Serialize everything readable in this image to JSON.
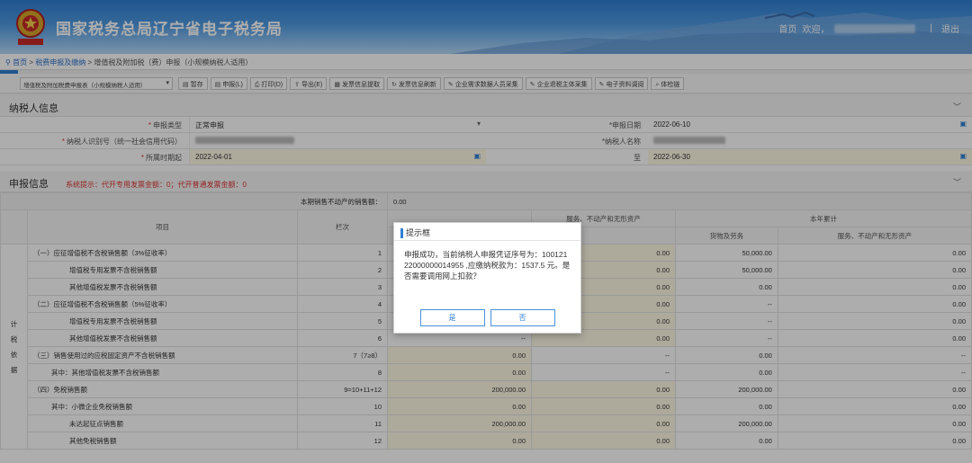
{
  "header": {
    "site_title": "国家税务总局辽宁省电子税务局",
    "nav_home": "首页",
    "nav_welcome": "欢迎，",
    "nav_sep": "|",
    "nav_logout": "退出"
  },
  "breadcrumb": {
    "pin": "⚲",
    "home": "首页",
    "sep1": ">",
    "item1": "税费申报及缴纳",
    "sep2": ">",
    "item2": "增值税及附加税（费）申报（小规模纳税人适用）"
  },
  "toolbar": {
    "menu_icon": "☰",
    "report_select": "增值税及附加税费申报表（小规模纳税人适用）",
    "buttons": [
      "暂存",
      "申报(L)",
      "打印(D)",
      "导出(E)",
      "发票信息提取",
      "发票信息刷新",
      "企业需求数据人员采集",
      "企业退税主体采集",
      "电子资料调阅",
      "体检链"
    ]
  },
  "taxpayer": {
    "section_title": "纳税人信息",
    "decl_type_label": "申报类型",
    "decl_type_value": "正常申报",
    "decl_date_label": "申报日期",
    "decl_date_value": "2022-06-10",
    "tax_id_label": "纳税人识别号（统一社会信用代码）",
    "name_label": "纳税人名称",
    "period_label": "所属时期起",
    "period_start": "2022-04-01",
    "period_to_label": "至",
    "period_end": "2022-06-30"
  },
  "declaration": {
    "section_title": "申报信息",
    "system_hint": "系统提示：代开专用发票金额：0；代开普通发票金额：0",
    "real_estate_label": "本期销售不动产的销售额：",
    "real_estate_value": "0.00",
    "col_item": "项目",
    "col_line": "栏次",
    "col_cumulative": "本年累计",
    "col_goods": "货物及劳务",
    "col_services": "服务、不动产和无形资产",
    "side_label": [
      "计",
      "税",
      "依",
      "据"
    ],
    "rows": [
      {
        "item": "（一）应征增值税不含税销售额（3%征收率）",
        "line": "1",
        "c1": "",
        "c2": "0.00",
        "c3": "50,000.00",
        "c4": "0.00"
      },
      {
        "item": "增值税专用发票不含税销售额",
        "line": "2",
        "c1": "",
        "c2": "0.00",
        "c3": "50,000.00",
        "c4": "0.00"
      },
      {
        "item": "其他增值税发票不含税销售额",
        "line": "3",
        "c1": "",
        "c2": "0.00",
        "c3": "0.00",
        "c4": "0.00"
      },
      {
        "item": "（二）应征增值税不含税销售额（5%征收率）",
        "line": "4",
        "c1": "",
        "c2": "0.00",
        "c3": "--",
        "c4": "0.00"
      },
      {
        "item": "增值税专用发票不含税销售额",
        "line": "5",
        "c1": "",
        "c2": "0.00",
        "c3": "--",
        "c4": "0.00"
      },
      {
        "item": "其他增值税发票不含税销售额",
        "line": "6",
        "c1": "--",
        "c2": "0.00",
        "c3": "--",
        "c4": "0.00"
      },
      {
        "item": "（三）销售使用过的应税固定资产不含税销售额",
        "line": "7（7≥8）",
        "c1": "0.00",
        "c2": "--",
        "c3": "0.00",
        "c4": "--"
      },
      {
        "item": "其中：其他增值税发票不含税销售额",
        "line": "8",
        "c1": "0.00",
        "c2": "--",
        "c3": "0.00",
        "c4": "--"
      },
      {
        "item": "（四）免税销售额",
        "line": "9=10+11+12",
        "c1": "200,000.00",
        "c2": "0.00",
        "c3": "200,000.00",
        "c4": "0.00"
      },
      {
        "item": "其中：小微企业免税销售额",
        "line": "10",
        "c1": "0.00",
        "c2": "0.00",
        "c3": "0.00",
        "c4": "0.00"
      },
      {
        "item": "未达起征点销售额",
        "line": "11",
        "c1": "200,000.00",
        "c2": "0.00",
        "c3": "200,000.00",
        "c4": "0.00"
      },
      {
        "item": "其他免税销售额",
        "line": "12",
        "c1": "0.00",
        "c2": "0.00",
        "c3": "0.00",
        "c4": "0.00"
      }
    ]
  },
  "dialog": {
    "title": "提示框",
    "message": "申报成功，当前纳税人申报凭证序号为：10012122000000014955 ,应缴纳税款为：1537.5 元。是否需要调用网上扣款？",
    "yes": "是",
    "no": "否"
  },
  "colors": {
    "header_blue": "#2f7fd3",
    "required_red": "#d33"
  }
}
